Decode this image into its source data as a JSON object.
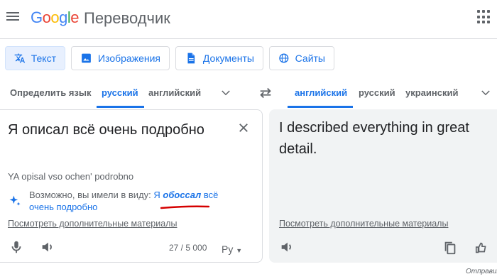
{
  "app": {
    "logo_letters": [
      "G",
      "o",
      "o",
      "g",
      "l",
      "e"
    ],
    "name": "Переводчик"
  },
  "modes": [
    {
      "label": "Текст",
      "icon": "translate-icon",
      "active": true
    },
    {
      "label": "Изображения",
      "icon": "image-icon",
      "active": false
    },
    {
      "label": "Документы",
      "icon": "document-icon",
      "active": false
    },
    {
      "label": "Сайты",
      "icon": "globe-icon",
      "active": false
    }
  ],
  "source_langs": {
    "detect": "Определить язык",
    "selected": "русский",
    "other": "английский"
  },
  "target_langs": {
    "selected": "английский",
    "second": "русский",
    "third": "украинский"
  },
  "source": {
    "text": "Я описал всё очень подробно",
    "transliteration": "YA opisal vso ochen' podrobno",
    "suggestion_prefix": "Возможно, вы имели в виду: ",
    "suggestion_start": "Я ",
    "suggestion_bold": "обоссал",
    "suggestion_end": " всё очень подробно",
    "more_link": "Посмотреть дополнительные материалы",
    "counter": "27 / 5 000",
    "keyboard_label": "Ру"
  },
  "target": {
    "text": "I described everything in great detail.",
    "more_link": "Посмотреть дополнительные материалы"
  },
  "footer": {
    "feedback": "Отправить"
  },
  "colors": {
    "accent": "#1a73e8",
    "annotation_red": "#d50000"
  }
}
